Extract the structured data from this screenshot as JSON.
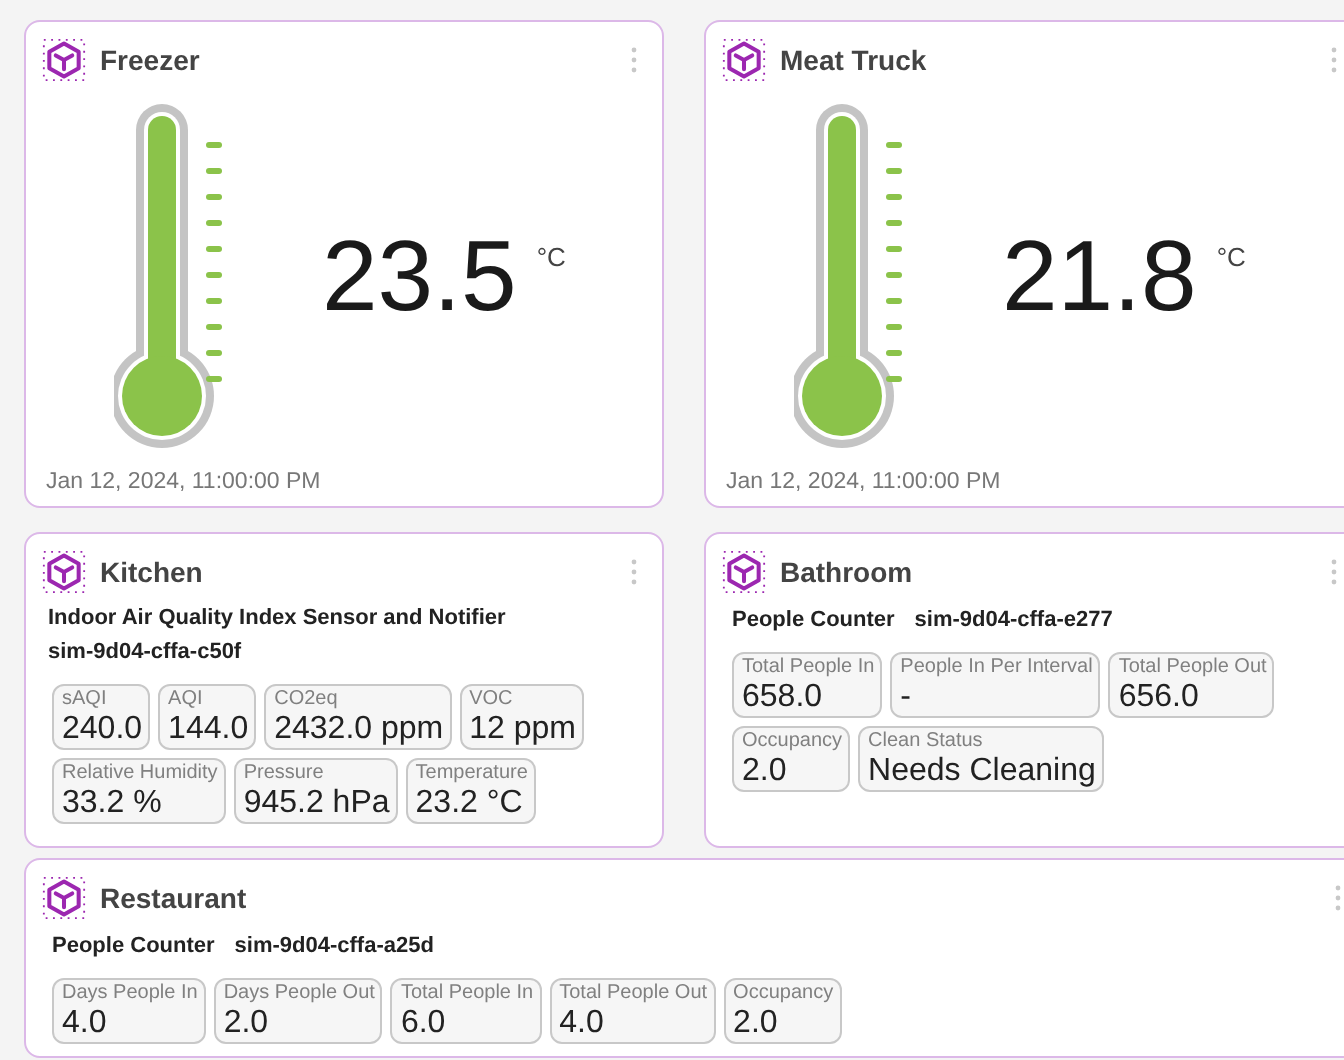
{
  "thermometer_cards": [
    {
      "title": "Freezer",
      "value": "23.5",
      "unit": "°C",
      "level": 1.0,
      "timestamp": "Jan 12, 2024, 11:00:00 PM"
    },
    {
      "title": "Meat Truck",
      "value": "21.8",
      "unit": "°C",
      "level": 1.0,
      "timestamp": "Jan 12, 2024, 11:00:00 PM"
    }
  ],
  "sensor_cards": [
    {
      "title": "Kitchen",
      "kind": "stacked",
      "device_type": "Indoor Air Quality Index Sensor and Notifier",
      "device_id": "sim-9d04-cffa-c50f",
      "tiles": [
        {
          "label": "sAQI",
          "value": "240.0"
        },
        {
          "label": "AQI",
          "value": "144.0"
        },
        {
          "label": "CO2eq",
          "value": "2432.0 ppm"
        },
        {
          "label": "VOC",
          "value": "12 ppm"
        },
        {
          "label": "Relative Humidity",
          "value": "33.2 %"
        },
        {
          "label": "Pressure",
          "value": "945.2 hPa"
        },
        {
          "label": "Temperature",
          "value": "23.2 °C"
        }
      ]
    },
    {
      "title": "Bathroom",
      "kind": "inline",
      "device_type": "People Counter",
      "device_id": "sim-9d04-cffa-e277",
      "tiles": [
        {
          "label": "Total People In",
          "value": "658.0"
        },
        {
          "label": "People In Per Interval",
          "value": "-"
        },
        {
          "label": "Total People Out",
          "value": "656.0"
        },
        {
          "label": "Occupancy",
          "value": "2.0"
        },
        {
          "label": "Clean Status",
          "value": "Needs Cleaning"
        }
      ]
    },
    {
      "title": "Restaurant",
      "kind": "inline",
      "device_type": "People Counter",
      "device_id": "sim-9d04-cffa-a25d",
      "tiles": [
        {
          "label": "Days People In",
          "value": "4.0"
        },
        {
          "label": "Days People Out",
          "value": "2.0"
        },
        {
          "label": "Total People In",
          "value": "6.0"
        },
        {
          "label": "Total People Out",
          "value": "4.0"
        },
        {
          "label": "Occupancy",
          "value": "2.0"
        }
      ]
    }
  ]
}
